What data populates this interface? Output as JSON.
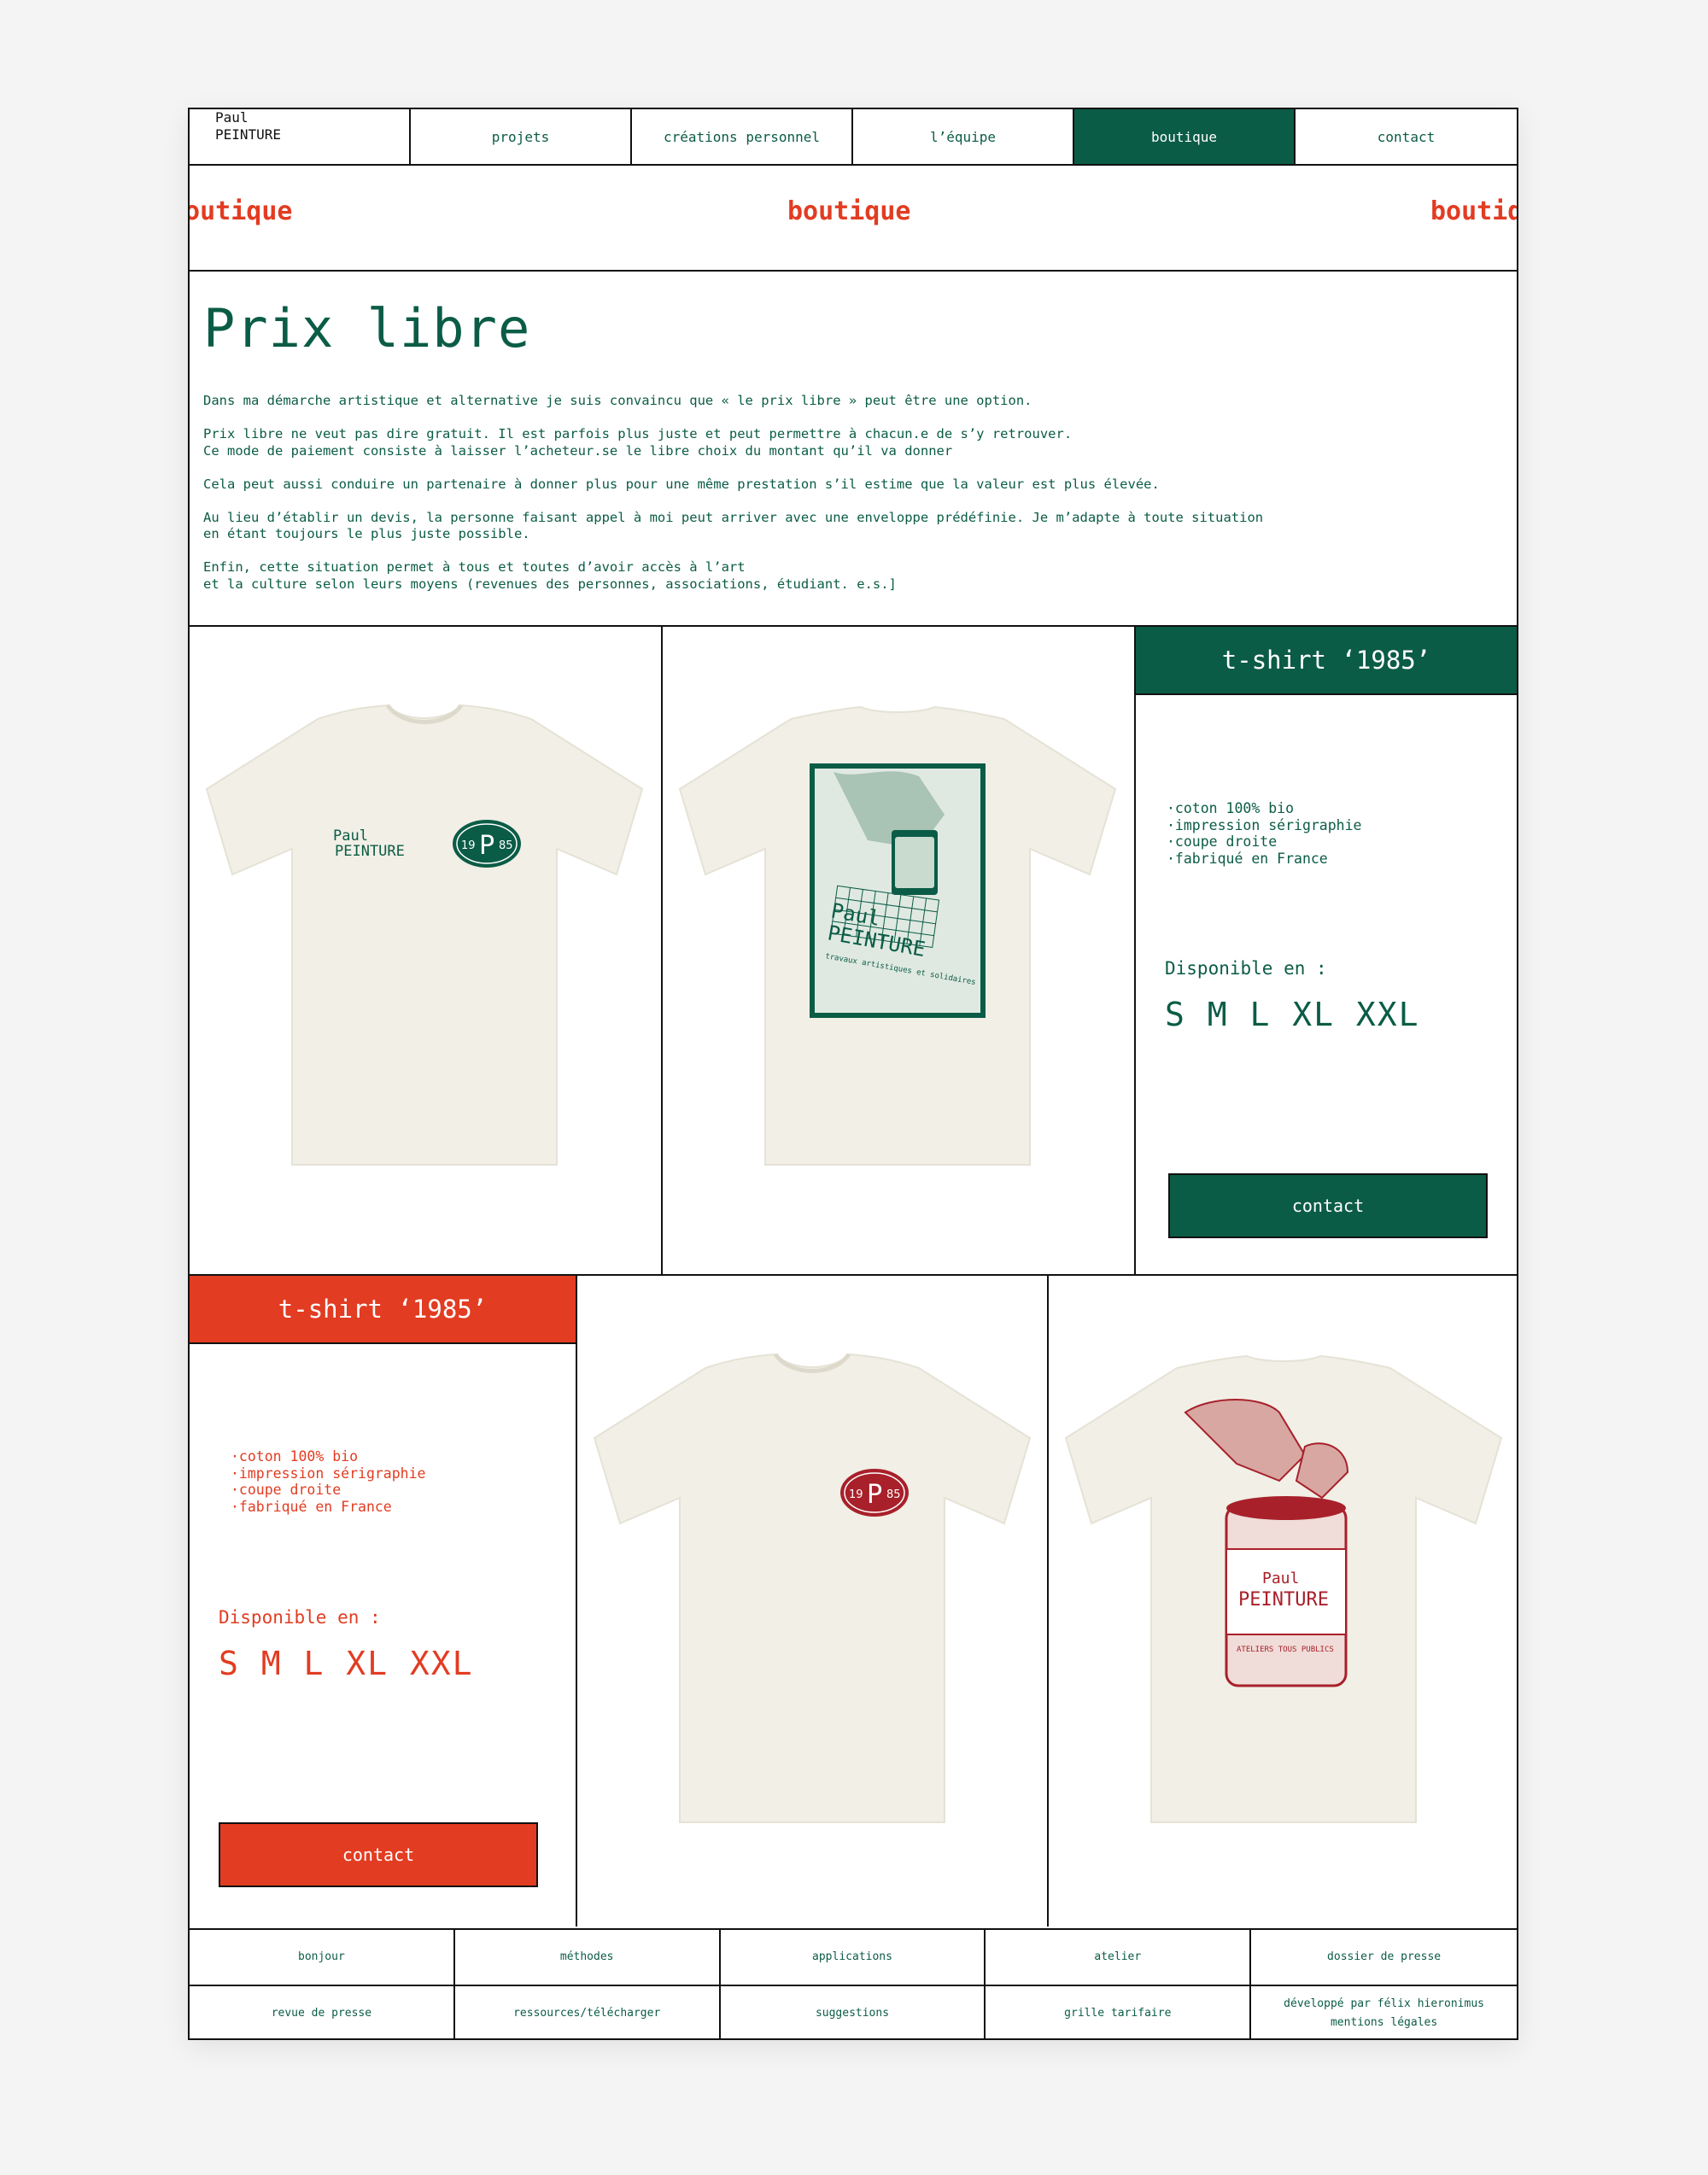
{
  "logo": {
    "line1": "Paul",
    "line2": "PEINTURE"
  },
  "nav": [
    {
      "label": "projets"
    },
    {
      "label": "créations personnel"
    },
    {
      "label": "l’équipe"
    },
    {
      "label": "boutique"
    },
    {
      "label": "contact"
    }
  ],
  "marquee": {
    "text": "boutique"
  },
  "intro": {
    "title": "Prix libre",
    "paragraphs": [
      "Dans ma démarche artistique et alternative je suis convaincu que « le prix libre » peut être une option.",
      "Prix libre ne veut pas dire gratuit. Il est parfois plus juste et peut permettre à chacun.e de s’y retrouver.\nCe mode de paiement consiste à laisser l’acheteur.se le libre choix du montant qu’il va donner",
      "Cela peut aussi conduire un partenaire à donner plus pour une même prestation s’il estime que la valeur est plus élevée.",
      "Au lieu d’établir un devis, la personne faisant appel à moi peut arriver avec une enveloppe prédéfinie. Je m’adapte à toute situation\nen étant toujours le plus juste possible.",
      "Enfin, cette situation permet à tous et toutes d’avoir accès à l’art\net la culture selon leurs moyens (revenues des personnes, associations, étudiant. e.s.]"
    ]
  },
  "products": [
    {
      "title": "t-shirt ‘1985’",
      "features": "·coton 100% bio\n·impression sérigraphie\n·coupe droite\n·fabriqué en France",
      "dispo": "Disponible en :",
      "sizes": "S M L XL XXL",
      "cta": "contact",
      "color": "#0b5c46"
    },
    {
      "title": "t-shirt ‘1985’",
      "features": "·coton 100% bio\n·impression sérigraphie\n·coupe droite\n·fabriqué en France",
      "dispo": "Disponible en :",
      "sizes": "S M L XL XXL",
      "cta": "contact",
      "color": "#e23c22"
    }
  ],
  "shirt_prints": {
    "front_logo_line1": "Paul",
    "front_logo_line2": "PEINTURE",
    "badge_left": "19",
    "badge_letter": "P",
    "badge_right": "85",
    "poster_line1": "Paul",
    "poster_line2": "PEINTURE",
    "poster_sub": "travaux artistiques et solidaires",
    "can_line1": "Paul",
    "can_line2": "PEINTURE",
    "can_sub": "ATELIERS TOUS PUBLICS"
  },
  "footer": {
    "row1": [
      "bonjour",
      "méthodes",
      "applications",
      "atelier",
      "dossier de presse"
    ],
    "row2": [
      "revue de presse",
      "ressources/télécharger",
      "suggestions",
      "grille tarifaire"
    ],
    "credit1": "développé par félix hieronimus",
    "credit2": "mentions légales"
  }
}
